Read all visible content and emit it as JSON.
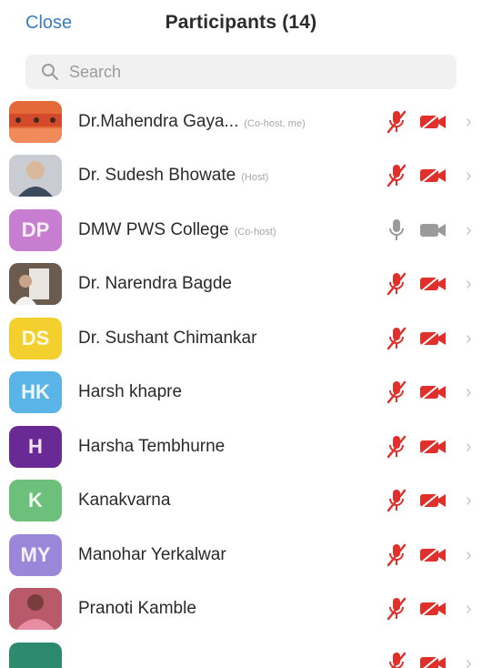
{
  "header": {
    "close_label": "Close",
    "title": "Participants (14)"
  },
  "search": {
    "placeholder": "Search"
  },
  "colors": {
    "accent_blue": "#3b7bbf",
    "muted_red": "#e0302b",
    "inactive_gray": "#9a9a9a"
  },
  "participants": [
    {
      "name": "Dr.Mahendra Gaya...",
      "role": "(Co-host, me)",
      "avatar_type": "photo",
      "photo_kind": "orange-flag",
      "initials": "",
      "avatar_color": "#e46a3a",
      "mic": "muted",
      "camera": "off"
    },
    {
      "name": "Dr. Sudesh Bhowate",
      "role": "(Host)",
      "avatar_type": "photo",
      "photo_kind": "portrait",
      "initials": "",
      "avatar_color": "#c9ccd3",
      "mic": "muted",
      "camera": "off"
    },
    {
      "name": "DMW PWS College",
      "role": "(Co-host)",
      "avatar_type": "initials",
      "photo_kind": "",
      "initials": "DP",
      "avatar_color": "#c77ed1",
      "mic": "inactive",
      "camera": "inactive"
    },
    {
      "name": "Dr. Narendra Bagde",
      "role": "",
      "avatar_type": "photo",
      "photo_kind": "group",
      "initials": "",
      "avatar_color": "#6b5a4e",
      "mic": "muted",
      "camera": "off"
    },
    {
      "name": "Dr. Sushant Chimankar",
      "role": "",
      "avatar_type": "initials",
      "photo_kind": "",
      "initials": "DS",
      "avatar_color": "#f4d02e",
      "mic": "muted",
      "camera": "off"
    },
    {
      "name": "Harsh khapre",
      "role": "",
      "avatar_type": "initials",
      "photo_kind": "",
      "initials": "HK",
      "avatar_color": "#5ab5e6",
      "mic": "muted",
      "camera": "off"
    },
    {
      "name": "Harsha Tembhurne",
      "role": "",
      "avatar_type": "initials",
      "photo_kind": "",
      "initials": "H",
      "avatar_color": "#6a2a96",
      "mic": "muted",
      "camera": "off"
    },
    {
      "name": "Kanakvarna",
      "role": "",
      "avatar_type": "initials",
      "photo_kind": "",
      "initials": "K",
      "avatar_color": "#6cc07b",
      "mic": "muted",
      "camera": "off"
    },
    {
      "name": "Manohar Yerkalwar",
      "role": "",
      "avatar_type": "initials",
      "photo_kind": "",
      "initials": "MY",
      "avatar_color": "#9b87d9",
      "mic": "muted",
      "camera": "off"
    },
    {
      "name": "Pranoti Kamble",
      "role": "",
      "avatar_type": "photo",
      "photo_kind": "pink",
      "initials": "",
      "avatar_color": "#b85a6a",
      "mic": "muted",
      "camera": "off"
    },
    {
      "name": "",
      "role": "",
      "avatar_type": "initials",
      "photo_kind": "",
      "initials": "",
      "avatar_color": "#2e8a6e",
      "mic": "muted",
      "camera": "off"
    }
  ]
}
